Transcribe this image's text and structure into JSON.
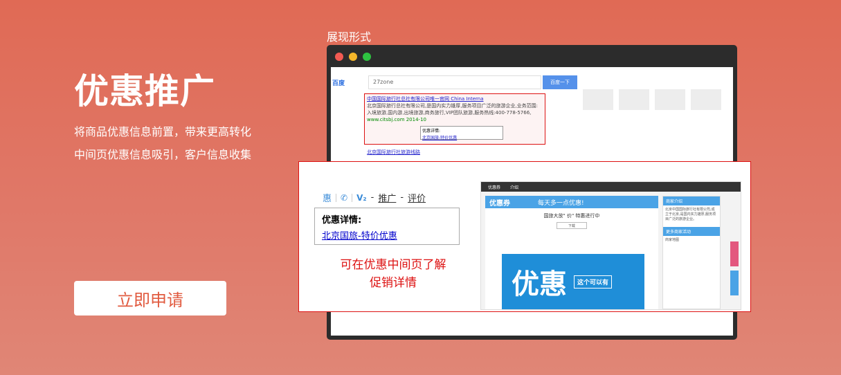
{
  "hero": {
    "title": "优惠推广",
    "line1": "将商品优惠信息前置，带来更高转化",
    "line2": "中间页优惠信息吸引，客户信息收集",
    "apply_button": "立即申请"
  },
  "display": {
    "label": "展现形式"
  },
  "browser": {
    "search_query": "27zone",
    "result_title": "中国国际旅行社总社有限公司唯一官网 China Interna",
    "result_snippet": "北京国际旅行总社有限公司,是国内实力雄厚,服务项目广泛的旅游企业,业务范围:入境旅游,国内游,出境旅游,商务旅行,VIP团队旅游,服务热线:400-778-5766,",
    "result_url": "www.citsbj.com 2014-10",
    "popup_title": "优惠详情:",
    "popup_link": "北京国旅-特价优惠",
    "second_result_title": "北京国际旅行社旅游线路"
  },
  "popout": {
    "tab_hui": "惠",
    "tab_v2": "V₂",
    "tab_sep1": "-",
    "tab_promote": "推广",
    "tab_sep2": "-",
    "tab_review": "评价",
    "detail_title": "优惠详情:",
    "detail_link": "北京国旅-特价优惠",
    "caption_line1": "可在优惠中间页了解",
    "caption_line2": "促销详情"
  },
  "mini": {
    "nav1": "优惠券",
    "nav2": "介绍",
    "head_title": "优惠券",
    "head_slogan": "每天多一点优惠!",
    "intro": "国旅大放\" 价\" 特惠进行中",
    "banner_text": "优惠",
    "banner_tag": "这个可以有",
    "side_header": "商家介绍",
    "side_text": "北京中国国际旅行社有限公司,成立于北京,是国内实力雄厚,服务项目广泛的旅游企业。",
    "side_more": "更多商家活动",
    "side_map": "商家地图"
  }
}
